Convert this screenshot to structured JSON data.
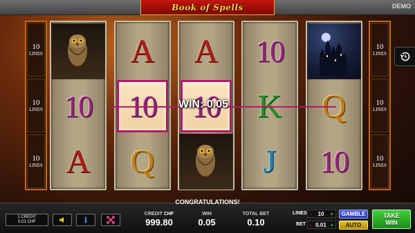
{
  "header": {
    "title": "Book of Spells",
    "demo_label": "DEMO"
  },
  "lines_indicator": {
    "left": [
      {
        "n": "10",
        "label": "LINES"
      },
      {
        "n": "10",
        "label": "LINES"
      },
      {
        "n": "10",
        "label": "LINES"
      }
    ],
    "right": [
      {
        "n": "10",
        "label": "LINES"
      },
      {
        "n": "10",
        "label": "LINES"
      },
      {
        "n": "10",
        "label": "LINES"
      }
    ]
  },
  "reels": [
    [
      "owl",
      "10",
      "A"
    ],
    [
      "A",
      "10",
      "Q"
    ],
    [
      "A",
      "10",
      "owl"
    ],
    [
      "10",
      "K",
      "J"
    ],
    [
      "castle",
      "Q",
      "10"
    ]
  ],
  "win_display": {
    "text": "WIN: 0.05",
    "symbol": "10",
    "winning_reels": [
      1,
      2,
      3
    ]
  },
  "panel": {
    "congrats": "CONGRATULATIONS!",
    "credit_box": {
      "line1": "1 CREDIT",
      "line2": "0.01 CHF"
    },
    "credit": {
      "label": "CREDIT",
      "currency": "CHF",
      "value": "999.80"
    },
    "win": {
      "label": "WIN",
      "value": "0.05"
    },
    "total_bet": {
      "label": "TOTAL BET",
      "value": "0.10"
    },
    "lines": {
      "label": "LINES",
      "value": "10"
    },
    "bet": {
      "label": "BET",
      "value": "0.01"
    },
    "gamble_label": "GAMBLE",
    "auto_label": "AUTO",
    "take_win": {
      "line1": "TAKE",
      "line2": "WIN"
    }
  },
  "colors": {
    "win_line": "#b0196b",
    "take_win": "#2fb22a",
    "gamble": "#3a4fd0",
    "auto": "#d4b012"
  }
}
